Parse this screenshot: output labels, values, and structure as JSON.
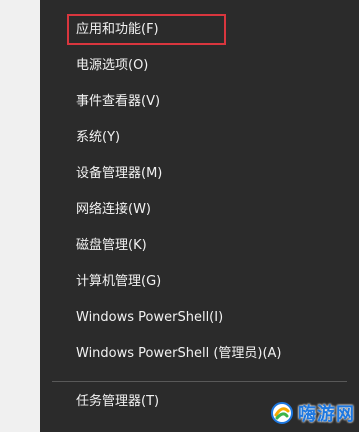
{
  "menu": {
    "items": [
      {
        "label": "应用和功能(F)"
      },
      {
        "label": "电源选项(O)"
      },
      {
        "label": "事件查看器(V)"
      },
      {
        "label": "系统(Y)"
      },
      {
        "label": "设备管理器(M)"
      },
      {
        "label": "网络连接(W)"
      },
      {
        "label": "磁盘管理(K)"
      },
      {
        "label": "计算机管理(G)"
      },
      {
        "label": "Windows PowerShell(I)"
      },
      {
        "label": "Windows PowerShell (管理员)(A)"
      }
    ],
    "bottom_items": [
      {
        "label": "任务管理器(T)"
      }
    ],
    "highlight_color": "#d9363e",
    "background_color": "#2b2b2b"
  },
  "watermark": {
    "text": "嗨游网",
    "icon": "haiyou-logo-icon",
    "color": "#1e78e0"
  }
}
